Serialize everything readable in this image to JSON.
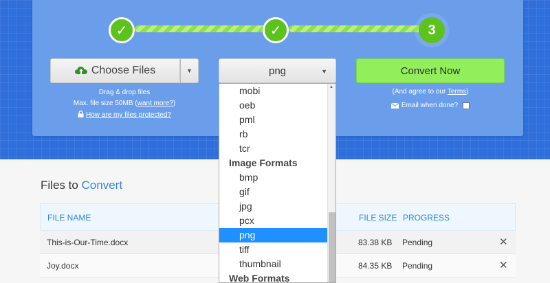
{
  "steps": [
    {
      "label": "✓"
    },
    {
      "label": "✓"
    },
    {
      "label": "3"
    }
  ],
  "upload": {
    "choose_label": "Choose Files",
    "drag_text": "Drag & drop files",
    "max_size_text": "Max. file size 50MB (",
    "want_more": "want more?",
    "max_size_close": ")",
    "protected_link": "How are my files protected?"
  },
  "format": {
    "selected": "png",
    "options": [
      {
        "kind": "option",
        "label": "mobi"
      },
      {
        "kind": "option",
        "label": "oeb"
      },
      {
        "kind": "option",
        "label": "pml"
      },
      {
        "kind": "option",
        "label": "rb"
      },
      {
        "kind": "option",
        "label": "tcr"
      },
      {
        "kind": "group",
        "label": "Image Formats"
      },
      {
        "kind": "option",
        "label": "bmp"
      },
      {
        "kind": "option",
        "label": "gif"
      },
      {
        "kind": "option",
        "label": "jpg"
      },
      {
        "kind": "option",
        "label": "pcx"
      },
      {
        "kind": "option",
        "label": "png",
        "selected": true
      },
      {
        "kind": "option",
        "label": "tiff"
      },
      {
        "kind": "option",
        "label": "thumbnail"
      },
      {
        "kind": "group",
        "label": "Web Formats"
      }
    ]
  },
  "convert": {
    "button_label": "Convert Now",
    "agree_prefix": "(And agree to our ",
    "terms_link": "Terms",
    "agree_suffix": ")",
    "email_label": "Email when done?"
  },
  "files": {
    "title_prefix": "Files to ",
    "title_accent": "Convert",
    "columns": {
      "name": "FILE NAME",
      "size": "FILE SIZE",
      "progress": "PROGRESS"
    },
    "rows": [
      {
        "name": "This-is-Our-Time.docx",
        "size": "83.38 KB",
        "progress": "Pending"
      },
      {
        "name": "Joy.docx",
        "size": "84.35 KB",
        "progress": "Pending"
      }
    ]
  },
  "colors": {
    "band": "#2f6fdc",
    "panel": "#6a9eea",
    "step_green": "#5cc21c",
    "convert_green": "#92ef5b",
    "accent_blue": "#2f86e0",
    "selected_option": "#1e90ff"
  },
  "icons": {
    "upload": "cloud-upload-icon",
    "lock": "lock-icon",
    "envelope": "envelope-icon",
    "remove": "close-icon"
  }
}
